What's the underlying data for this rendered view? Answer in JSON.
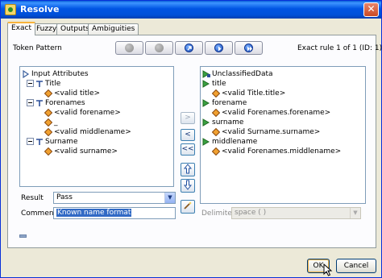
{
  "window": {
    "title": "Resolve"
  },
  "tabs": [
    "Exact",
    "Fuzzy",
    "Outputs",
    "Ambiguities"
  ],
  "panel": {
    "token_pattern_label": "Token Pattern",
    "rule_status": "Exact rule 1 of 1 (ID: 1)",
    "nav_buttons": [
      {
        "name": "first-icon",
        "enabled": false
      },
      {
        "name": "previous-icon",
        "enabled": false
      },
      {
        "name": "add-icon",
        "enabled": true
      },
      {
        "name": "next-icon",
        "enabled": true
      },
      {
        "name": "last-icon",
        "enabled": true
      }
    ]
  },
  "left_tree": {
    "root": "Input Attributes",
    "items": [
      {
        "label": "Title",
        "children": [
          "<valid title>"
        ]
      },
      {
        "label": "Forenames",
        "children": [
          "<valid forename>",
          "_",
          "<valid middlename>"
        ]
      },
      {
        "label": "Surname",
        "children": [
          "<valid surname>"
        ]
      }
    ]
  },
  "right_tree": {
    "root": "UnclassifiedData",
    "items": [
      {
        "label": "title",
        "children": [
          "<valid Title.title>"
        ]
      },
      {
        "label": "forename",
        "children": [
          "<valid Forenames.forename>"
        ]
      },
      {
        "label": "surname",
        "children": [
          "<valid Surname.surname>"
        ]
      },
      {
        "label": "middlename",
        "children": [
          "<valid Forenames.middlename>"
        ]
      }
    ]
  },
  "mid_buttons": [
    ">",
    "<",
    "<<"
  ],
  "result": {
    "label": "Result",
    "value": "Pass"
  },
  "comment": {
    "label": "Comment",
    "value": "Known name format"
  },
  "delimiter": {
    "label": "Delimiter",
    "value": "space ( )"
  },
  "buttons": {
    "ok": "OK",
    "cancel": "Cancel"
  },
  "colors": {
    "title_bar": "#0054e3",
    "tab_highlight": "#f8b33a",
    "selection": "#316ac5"
  }
}
